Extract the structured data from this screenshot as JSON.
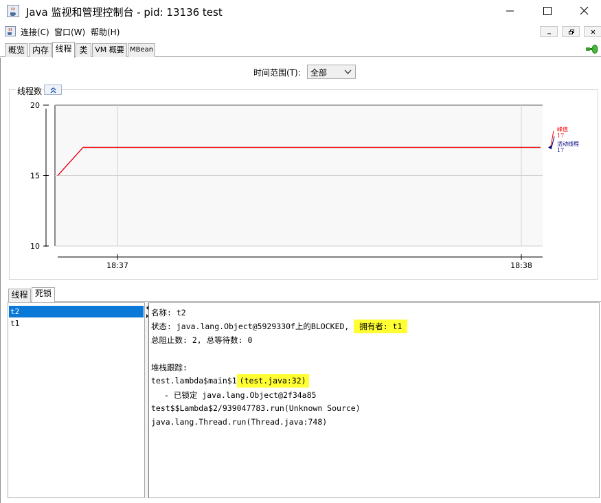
{
  "window": {
    "title": "Java 监视和管理控制台 - pid: 13136 test",
    "app_icon": "java-cup-icon",
    "controls": [
      "minimize-icon",
      "maximize-icon",
      "close-icon"
    ]
  },
  "menubar": {
    "items": [
      "连接(C)",
      "窗口(W)",
      "帮助(H)"
    ]
  },
  "tabs": {
    "items": [
      "概览",
      "内存",
      "线程",
      "类",
      "VM 概要",
      "MBean"
    ],
    "selected": "线程",
    "connection_icon": "connected-plug-icon"
  },
  "time_range": {
    "label": "时间范围(T):",
    "value": "全部"
  },
  "chart_panel": {
    "title": "线程数",
    "collapse_icon": "double-chevron-up-icon"
  },
  "chart_data": {
    "type": "line",
    "ylim": [
      10,
      20
    ],
    "yticks": [
      "10",
      "15",
      "20"
    ],
    "xticks": [
      "18:37",
      "18:38"
    ],
    "series": [
      {
        "name": "峰值",
        "color": "#ff0000",
        "x": [
          0,
          1,
          2
        ],
        "values": [
          15,
          17,
          17
        ]
      },
      {
        "name": "活动线程",
        "color": "#000080",
        "x": [
          0,
          1,
          2
        ],
        "values": [
          15,
          17,
          17
        ]
      }
    ],
    "legend": [
      {
        "name": "峰值",
        "value": "17",
        "color": "#ff0000"
      },
      {
        "name": "活动线程",
        "value": "17",
        "color": "#000080"
      }
    ],
    "legend_position": "right",
    "grid": true
  },
  "subtabs": {
    "items": [
      "线程",
      "死锁"
    ],
    "selected": "死锁"
  },
  "thread_list": {
    "items": [
      "t2",
      "t1"
    ],
    "selected": "t2"
  },
  "detail": {
    "name_line": "名称: t2",
    "state_prefix": "状态: java.lang.Object@5929330f上的BLOCKED,",
    "state_owner": "拥有者: t1",
    "counts_line": "总阻止数: 2, 总等待数: 0",
    "stack_label": "堆栈跟踪:",
    "stack_frame1_prefix": "test.lambda$main$1",
    "stack_frame1_location": "(test.java:32)",
    "locked_line": "- 已锁定 java.lang.Object@2f34a85",
    "stack_frame2": "test$$Lambda$2/939047783.run(Unknown Source)",
    "stack_frame3": "java.lang.Thread.run(Thread.java:748)"
  },
  "colors": {
    "selection": "#0a78d7",
    "highlight": "#ffff33",
    "chart_line": "#000080",
    "peak": "#ff0000"
  }
}
